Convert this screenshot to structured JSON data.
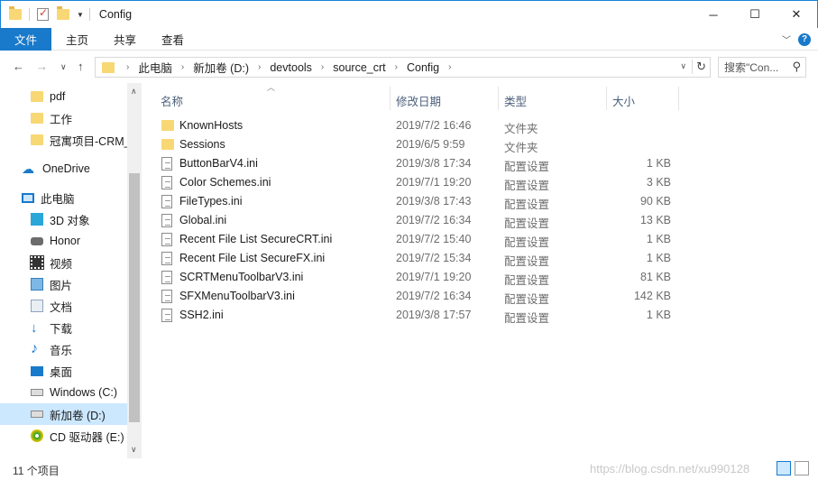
{
  "titlebar": {
    "title": "Config",
    "minimize_glyph": "─",
    "maximize_glyph": "☐",
    "close_glyph": "✕"
  },
  "ribbon": {
    "file_tab": "文件",
    "tabs": [
      "主页",
      "共享",
      "查看"
    ]
  },
  "address": {
    "crumbs": [
      "此电脑",
      "新加卷 (D:)",
      "devtools",
      "source_crt",
      "Config"
    ],
    "search_placeholder": "搜索\"Con..."
  },
  "sidebar": {
    "items": [
      {
        "label": "pdf",
        "icon": "folder-icon"
      },
      {
        "label": "工作",
        "icon": "folder-icon"
      },
      {
        "label": "冠寓项目-CRM_",
        "icon": "folder-icon"
      },
      {
        "label": "OneDrive",
        "icon": "onedrive-icon"
      },
      {
        "label": "此电脑",
        "icon": "pc-icon"
      },
      {
        "label": "3D 对象",
        "icon": "3d-objects-icon"
      },
      {
        "label": "Honor",
        "icon": "device-icon"
      },
      {
        "label": "视频",
        "icon": "video-icon"
      },
      {
        "label": "图片",
        "icon": "pictures-icon"
      },
      {
        "label": "文档",
        "icon": "documents-icon"
      },
      {
        "label": "下载",
        "icon": "download-icon"
      },
      {
        "label": "音乐",
        "icon": "music-icon"
      },
      {
        "label": "桌面",
        "icon": "desktop-icon"
      },
      {
        "label": "Windows (C:)",
        "icon": "drive-icon"
      },
      {
        "label": "新加卷 (D:)",
        "icon": "drive-icon"
      },
      {
        "label": "CD 驱动器 (E:) H",
        "icon": "cd-drive-icon"
      }
    ],
    "selected_label": "新加卷 (D:)"
  },
  "filelist": {
    "columns": {
      "name": "名称",
      "date": "修改日期",
      "type": "类型",
      "size": "大小"
    },
    "rows": [
      {
        "name": "KnownHosts",
        "date": "2019/7/2 16:46",
        "type": "文件夹",
        "size": "",
        "kind": "folder"
      },
      {
        "name": "Sessions",
        "date": "2019/6/5 9:59",
        "type": "文件夹",
        "size": "",
        "kind": "folder"
      },
      {
        "name": "ButtonBarV4.ini",
        "date": "2019/3/8 17:34",
        "type": "配置设置",
        "size": "1 KB",
        "kind": "ini"
      },
      {
        "name": "Color Schemes.ini",
        "date": "2019/7/1 19:20",
        "type": "配置设置",
        "size": "3 KB",
        "kind": "ini"
      },
      {
        "name": "FileTypes.ini",
        "date": "2019/3/8 17:43",
        "type": "配置设置",
        "size": "90 KB",
        "kind": "ini"
      },
      {
        "name": "Global.ini",
        "date": "2019/7/2 16:34",
        "type": "配置设置",
        "size": "13 KB",
        "kind": "ini"
      },
      {
        "name": "Recent File List SecureCRT.ini",
        "date": "2019/7/2 15:40",
        "type": "配置设置",
        "size": "1 KB",
        "kind": "ini"
      },
      {
        "name": "Recent File List SecureFX.ini",
        "date": "2019/7/2 15:34",
        "type": "配置设置",
        "size": "1 KB",
        "kind": "ini"
      },
      {
        "name": "SCRTMenuToolbarV3.ini",
        "date": "2019/7/1 19:20",
        "type": "配置设置",
        "size": "81 KB",
        "kind": "ini"
      },
      {
        "name": "SFXMenuToolbarV3.ini",
        "date": "2019/7/2 16:34",
        "type": "配置设置",
        "size": "142 KB",
        "kind": "ini"
      },
      {
        "name": "SSH2.ini",
        "date": "2019/3/8 17:57",
        "type": "配置设置",
        "size": "1 KB",
        "kind": "ini"
      }
    ]
  },
  "statusbar": {
    "count": "11 个项目",
    "watermark": "https://blog.csdn.net/xu990128"
  },
  "colors": {
    "accent": "#1979ca",
    "selected_bg": "#cce8ff",
    "folder": "#f8d775"
  }
}
